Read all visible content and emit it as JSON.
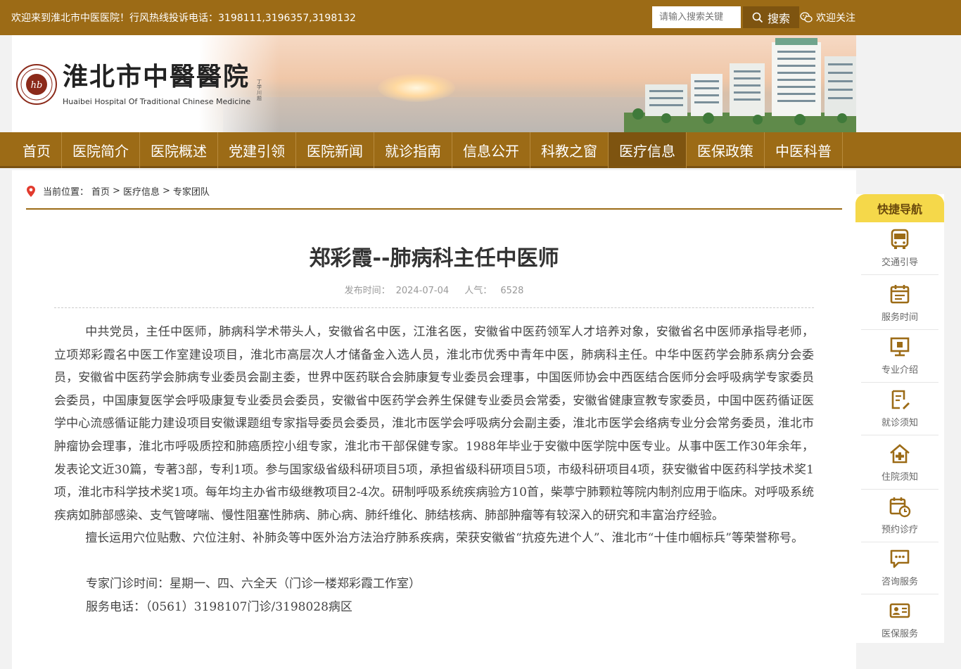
{
  "topbar": {
    "welcome": "欢迎来到淮北市中医医院！行风热线投诉电话：3198111,3196357,3198132",
    "search_placeholder": "请输入搜索关键",
    "search_label": "搜索",
    "follow_label": "欢迎关注"
  },
  "logo": {
    "name_cn": "淮北市中醫醫院",
    "name_en": "Huaibei Hospital Of Traditional Chinese Medicine",
    "signature": "丁学川题"
  },
  "nav": {
    "items": [
      {
        "label": "首页"
      },
      {
        "label": "医院简介"
      },
      {
        "label": "医院概述"
      },
      {
        "label": "党建引领"
      },
      {
        "label": "医院新闻"
      },
      {
        "label": "就诊指南"
      },
      {
        "label": "信息公开"
      },
      {
        "label": "科教之窗"
      },
      {
        "label": "医疗信息"
      },
      {
        "label": "医保政策"
      },
      {
        "label": "中医科普"
      }
    ],
    "active_index": 8
  },
  "breadcrumb": {
    "prefix": "当前位置：",
    "items": [
      "首页",
      "医疗信息",
      "专家团队"
    ],
    "sep": ">"
  },
  "article": {
    "title": "郑彩霞--肺病科主任中医师",
    "publish_label": "发布时间：",
    "publish_date": "2024-07-04",
    "views_label": "人气：",
    "views": "6528",
    "paragraph1": "中共党员，主任中医师，肺病科学术带头人，安徽省名中医，江淮名医，安徽省中医药领军人才培养对象，安徽省名中医师承指导老师，立项郑彩霞名中医工作室建设项目，淮北市高层次人才储备金入选人员，淮北市优秀中青年中医，肺病科主任。中华中医药学会肺系病分会委员，安徽省中医药学会肺病专业委员会副主委，世界中医药联合会肺康复专业委员会理事，中国医师协会中西医结合医师分会呼吸病学专家委员会委员，中国康复医学会呼吸康复专业委员会委员，安徽省中医药学会养生保健专业委员会常委，安徽省健康宣教专家委员，中国中医药循证医学中心流感循证能力建设项目安徽课题组专家指导委员会委员，淮北市医学会呼吸病分会副主委，淮北市医学会络病专业分会常务委员，淮北市肿瘤协会理事，淮北市呼吸质控和肺癌质控小组专家，淮北市干部保健专家。1988年毕业于安徽中医学院中医专业。从事中医工作30年余年，发表论文近30篇，专著3部，专利1项。参与国家级省级科研项目5项，承担省级科研项目5项，市级科研项目4项，获安徽省中医药科学技术奖1项，淮北市科学技术奖1项。每年均主办省市级继教项目2-4次。研制呼吸系统疾病验方10首，柴葶宁肺颗粒等院内制剂应用于临床。对呼吸系统疾病如肺部感染、支气管哮喘、慢性阻塞性肺病、肺心病、肺纤维化、肺结核病、肺部肿瘤等有较深入的研究和丰富治疗经验。",
    "paragraph2": "擅长运用穴位贴敷、穴位注射、补肺灸等中医外治方法治疗肺系疾病，荣获安徽省“抗疫先进个人”、淮北市“十佳巾帼标兵”等荣誉称号。",
    "clinic_hours": "专家门诊时间：星期一、四、六全天（门诊一楼郑彩霞工作室）",
    "service_phone": "服务电话：（0561）3198107门诊/3198028病区"
  },
  "quick_nav": {
    "title": "快捷导航",
    "items": [
      {
        "label": "交通引导",
        "icon": "bus-icon"
      },
      {
        "label": "服务时间",
        "icon": "calendar-icon"
      },
      {
        "label": "专业介绍",
        "icon": "presentation-icon"
      },
      {
        "label": "就诊须知",
        "icon": "document-edit-icon"
      },
      {
        "label": "住院须知",
        "icon": "hospital-icon"
      },
      {
        "label": "预约诊疗",
        "icon": "appointment-icon"
      },
      {
        "label": "咨询服务",
        "icon": "chat-icon"
      },
      {
        "label": "医保服务",
        "icon": "id-card-icon"
      }
    ]
  },
  "colors": {
    "brand": "#9c6b16",
    "brand_dark": "#7e5410",
    "quick_nav_header": "#f5d84a"
  }
}
